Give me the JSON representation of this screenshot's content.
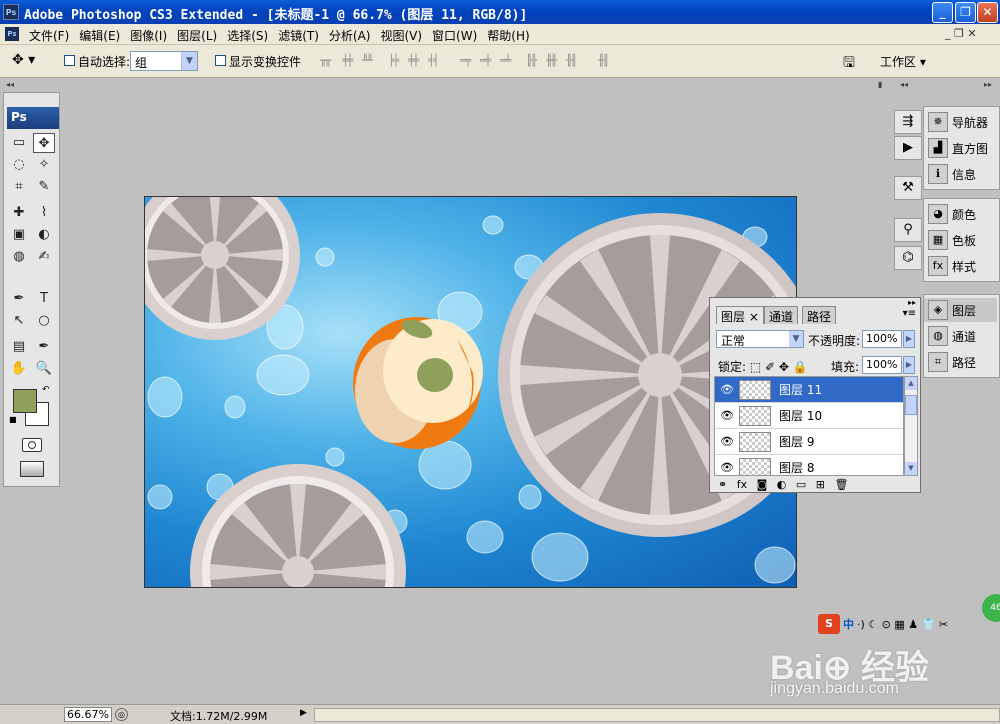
{
  "window": {
    "app_icon": "Ps",
    "title": "Adobe Photoshop CS3 Extended - [未标题-1 @ 66.7% (图层 11, RGB/8)]",
    "minimize": "_",
    "maximize": "❐",
    "close": "✕"
  },
  "menu": {
    "items": [
      "文件(F)",
      "编辑(E)",
      "图像(I)",
      "图层(L)",
      "选择(S)",
      "滤镜(T)",
      "分析(A)",
      "视图(V)",
      "窗口(W)",
      "帮助(H)"
    ],
    "doc_controls": "_  ❐  ✕"
  },
  "options": {
    "tool_icon": "move-tool-icon",
    "auto_select_label": "自动选择:",
    "auto_select_value": "组",
    "show_transform_label": "显示变换控件",
    "workspace_label": "工作区 ▾"
  },
  "toolbox": {
    "logo": "Ps",
    "tools": [
      "▭",
      "✥",
      "◌",
      "✧",
      "⌗",
      "✎",
      "✚",
      "⌇",
      "▣",
      "◐",
      "◍",
      "✍",
      "✒",
      "T",
      "↖",
      "○",
      "▤",
      "✒",
      "✋",
      "🔍"
    ],
    "fg_color": "#8fa05a",
    "bg_color": "#ffffff"
  },
  "dock_icons": [
    "⇶",
    "▶",
    "⚒",
    "⚲",
    "⌬"
  ],
  "panels": {
    "group1": [
      "导航器",
      "直方图",
      "信息"
    ],
    "group2": [
      "颜色",
      "色板",
      "样式"
    ],
    "group3": [
      "图层",
      "通道",
      "路径"
    ]
  },
  "layers_panel": {
    "tabs": [
      "图层 ×",
      "通道",
      "路径"
    ],
    "blend_mode": "正常",
    "opacity_label": "不透明度:",
    "opacity_value": "100%",
    "lock_label": "锁定:",
    "lock_icons": "⬚ ✐ ✥ 🔒",
    "fill_label": "填充:",
    "fill_value": "100%",
    "layers": [
      {
        "name": "图层 11",
        "visible": true,
        "selected": true
      },
      {
        "name": "图层 10",
        "visible": true,
        "selected": false
      },
      {
        "name": "图层 9",
        "visible": true,
        "selected": false
      },
      {
        "name": "图层 8",
        "visible": true,
        "selected": false
      }
    ],
    "footer_icons": "⚭ fx ◙ ◐ ▭ ⊞ 🗑"
  },
  "statusbar": {
    "zoom": "66.67%",
    "doc_info": "文档:1.72M/2.99M",
    "arrow": "▶"
  },
  "ime": {
    "s_icon": "S",
    "mode": "中",
    "icons": "·) ☾ ⊙ ▦ ♟ 👕 ✂",
    "badge": "46"
  },
  "watermark": {
    "brand": "Bai⊕ 经验",
    "url": "jingyan.baidu.com"
  },
  "colors": {
    "canvas_blue": "#1f87d2",
    "citrus_gray": "#a79e9e",
    "orange": "#f07a12",
    "selection": "#3169c6"
  }
}
